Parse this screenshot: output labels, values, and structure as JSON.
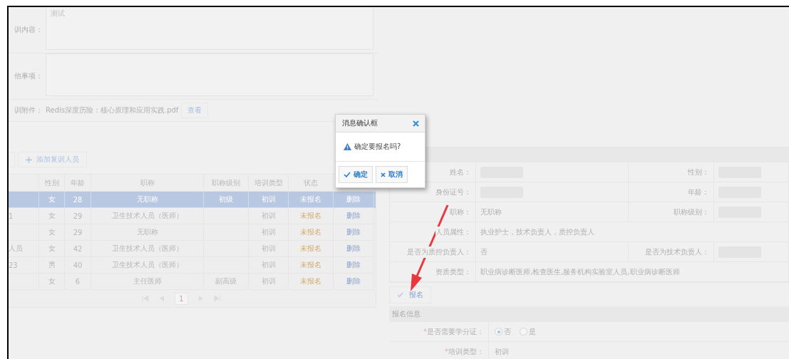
{
  "training_form": {
    "rows": [
      {
        "kind": "textarea",
        "label": "训内容：",
        "value": "测试"
      },
      {
        "kind": "textarea",
        "label": "他事项："
      },
      {
        "kind": "file",
        "label": "训附件：",
        "file_name": "Redis深度历险：核心原理和应用实践.pdf",
        "action": "查看"
      }
    ]
  },
  "toolbar": {
    "add_button": "添加复训人员"
  },
  "trainees_table": {
    "columns": [
      "性别",
      "年龄",
      "职称",
      "职称级别",
      "培训类型",
      "状态"
    ],
    "rows": [
      {
        "selected": true,
        "gender": "女",
        "age": "28",
        "title": "无职称",
        "title_level": "初级",
        "training_type": "初训",
        "status": "未报名",
        "action": "删除"
      },
      {
        "selected": false,
        "column_1": "1",
        "gender": "女",
        "age": "29",
        "title": "卫生技术人员（医师）",
        "training_type": "初训",
        "status": "未报名",
        "action": "删除"
      },
      {
        "selected": false,
        "gender": "女",
        "age": "29",
        "title": "无职称",
        "training_type": "初训",
        "status": "未报名",
        "action": "删除"
      },
      {
        "selected": false,
        "column_1": "人员",
        "gender": "女",
        "age": "42",
        "title": "卫生技术人员（医师）",
        "training_type": "初训",
        "status": "未报名",
        "action": "删除"
      },
      {
        "selected": false,
        "column_1": "23",
        "gender": "男",
        "age": "40",
        "title": "卫生技术人员（医师）",
        "training_type": "初训",
        "status": "未报名",
        "action": "删除"
      },
      {
        "selected": false,
        "gender": "女",
        "age": "6",
        "title": "主任医师",
        "title_level": "副高级",
        "training_type": "初训",
        "status": "未报名",
        "action": "删除"
      }
    ],
    "pager": {
      "current_page": "1"
    }
  },
  "personnel_info": {
    "rows": [
      {
        "fields": [
          {
            "label": "姓名：",
            "redacted": true
          },
          {
            "label": "性别：",
            "redacted": true
          }
        ]
      },
      {
        "fields": [
          {
            "label": "身份证号：",
            "redacted": true
          },
          {
            "label": "年龄：",
            "redacted": true
          }
        ]
      },
      {
        "fields": [
          {
            "label": "职称：",
            "value": "无职称"
          },
          {
            "label": "职称级别：",
            "redacted": true
          }
        ]
      },
      {
        "fields": [
          {
            "label": "人员属性：",
            "value": "执业护士，技术负责人，质控负责人"
          }
        ]
      },
      {
        "fields": [
          {
            "label": "是否为质控负责人：",
            "value": "否"
          },
          {
            "label": "是否为技术负责人：",
            "redacted": true
          }
        ]
      },
      {
        "fields": [
          {
            "label": "资质类型：",
            "value": "职业病诊断医师,检查医生,服务机构实验室人员,职业病诊断医师"
          }
        ]
      }
    ]
  },
  "signup_button": "报名",
  "signup_section": {
    "title": "报名信息",
    "fields": [
      {
        "kind": "radio",
        "mark": "*",
        "label": "是否需要学分证：",
        "options": [
          {
            "label": "否",
            "selected": true
          },
          {
            "label": "是",
            "selected": false
          }
        ]
      },
      {
        "kind": "text",
        "mark": "*",
        "label": "培训类型：",
        "value": "初训"
      }
    ]
  },
  "dialog": {
    "title": "消息确认框",
    "message": "确定要报名吗?",
    "buttons": [
      {
        "kind": "confirm",
        "label": "确定"
      },
      {
        "kind": "cancel",
        "label": "取消"
      }
    ]
  }
}
